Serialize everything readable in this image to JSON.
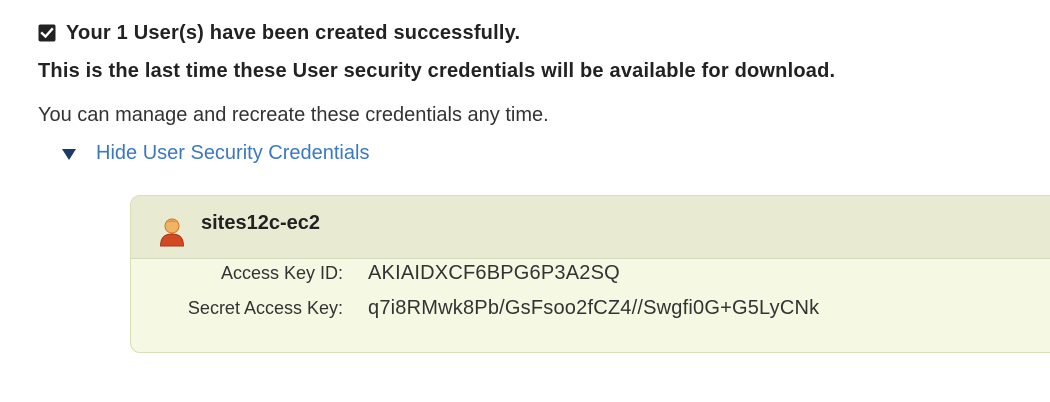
{
  "messages": {
    "success": "Your 1 User(s) have been created successfully.",
    "warning": "This is the last time these User security credentials will be available for download.",
    "info": "You can manage and recreate these credentials any time."
  },
  "toggle": {
    "label": "Hide User Security Credentials"
  },
  "credentials": {
    "user_name": "sites12c-ec2",
    "access_key_label": "Access Key ID:",
    "access_key_value": "AKIAIDXCF6BPG6P3A2SQ",
    "secret_key_label": "Secret Access Key:",
    "secret_key_value": "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"
  },
  "colors": {
    "link": "#3b78c2",
    "panel_background": "#f5f8e2",
    "panel_header": "#e8ebd2"
  },
  "icons": {
    "success": "checkbox-checked-icon",
    "toggle": "triangle-down-icon",
    "user": "user-icon"
  }
}
